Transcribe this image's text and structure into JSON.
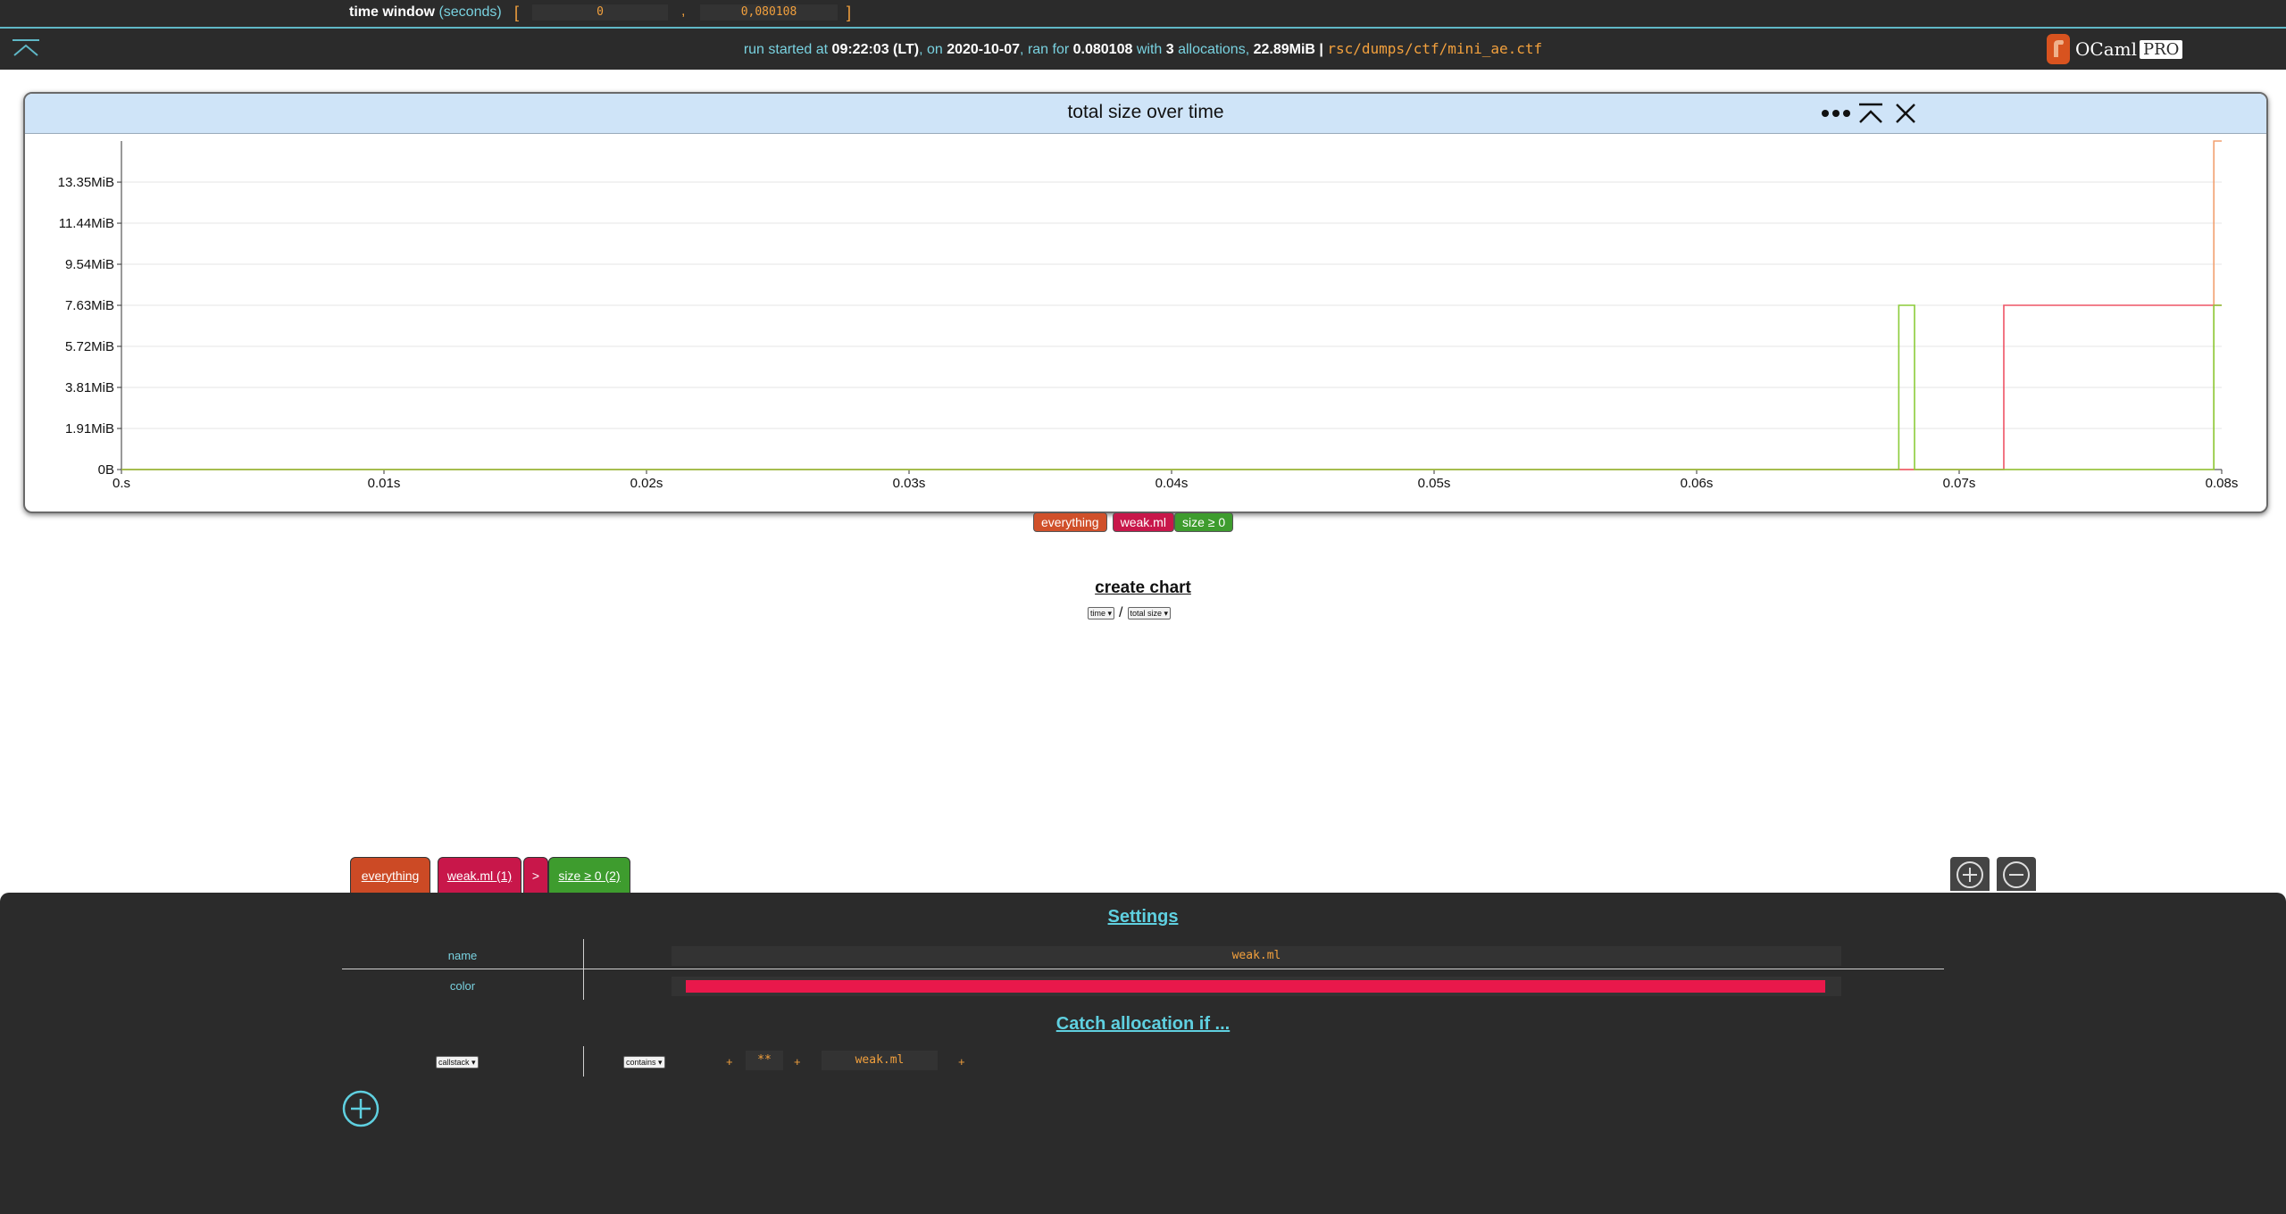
{
  "top": {
    "time_window_label": "time window",
    "time_window_unit": "(seconds)",
    "open_bracket": "[",
    "close_bracket": "]",
    "comma": ",",
    "start_value": "0",
    "end_value": "0,080108"
  },
  "info": {
    "prefix": "run started at",
    "time": "09:22:03 (LT)",
    "on": ", on",
    "date": "2020-10-07",
    "ran_for": ", ran for",
    "duration": "0.080108",
    "with": "with",
    "alloc_count": "3",
    "allocations": "allocations,",
    "total_size": "22.89MiB",
    "separator": "|",
    "path": "rsc/dumps/ctf/mini_ae.ctf"
  },
  "logo": {
    "ocaml": "OCaml",
    "pro": "PRO"
  },
  "chart": {
    "title": "total size over time",
    "icons": [
      "more-icon",
      "collapse-icon",
      "close-icon"
    ]
  },
  "chart_data": {
    "type": "line",
    "title": "total size over time",
    "xlabel": "",
    "ylabel": "",
    "x_ticks": [
      "0.s",
      "0.01s",
      "0.02s",
      "0.03s",
      "0.04s",
      "0.05s",
      "0.06s",
      "0.07s",
      "0.08s"
    ],
    "y_ticks": [
      "0B",
      "1.91MiB",
      "3.81MiB",
      "5.72MiB",
      "7.63MiB",
      "9.54MiB",
      "11.44MiB",
      "13.35MiB"
    ],
    "xlim": [
      0,
      0.08
    ],
    "ylim_mib": [
      0,
      15.26
    ],
    "grid": true,
    "series": [
      {
        "name": "everything",
        "color": "#f2a070",
        "points": [
          [
            0,
            0
          ],
          [
            0.0797,
            0
          ],
          [
            0.0797,
            15.26
          ],
          [
            0.08,
            15.26
          ]
        ]
      },
      {
        "name": "weak.ml",
        "color": "#ee5566",
        "points": [
          [
            0,
            0
          ],
          [
            0.0717,
            0
          ],
          [
            0.0717,
            7.63
          ],
          [
            0.08,
            7.63
          ]
        ]
      },
      {
        "name": "size ≥ 0",
        "color": "#8ccc3a",
        "points": [
          [
            0,
            0
          ],
          [
            0.0677,
            0
          ],
          [
            0.0677,
            7.63
          ],
          [
            0.0683,
            7.63
          ],
          [
            0.0683,
            0
          ],
          [
            0.0797,
            0
          ],
          [
            0.0797,
            7.63
          ],
          [
            0.08,
            7.63
          ]
        ]
      }
    ]
  },
  "legend": [
    {
      "label": "everything",
      "color": "#d0502a"
    },
    {
      "label": "weak.ml",
      "color": "#c8174a"
    },
    {
      "label": "size ≥ 0",
      "color": "#3e9c2e"
    }
  ],
  "create": {
    "title": "create chart",
    "x_select": "time",
    "slash": "/",
    "y_select": "total size"
  },
  "tabs": [
    {
      "label": "everything",
      "color": "#cc4a25"
    },
    {
      "label": "weak.ml (1)",
      "color": "#c8174a"
    },
    {
      "label": ">",
      "color": "#c8174a"
    },
    {
      "label": "size ≥ 0 (2)",
      "color": "#3e9c2e"
    }
  ],
  "settings": {
    "title": "Settings",
    "name_label": "name",
    "name_value": "weak.ml",
    "color_label": "color",
    "color_value": "#e9184b",
    "catch_title": "Catch allocation if ...",
    "filter_kind": "callstack",
    "filter_op": "contains",
    "plus": "+",
    "pattern1": "**",
    "pattern2": "weak.ml"
  }
}
